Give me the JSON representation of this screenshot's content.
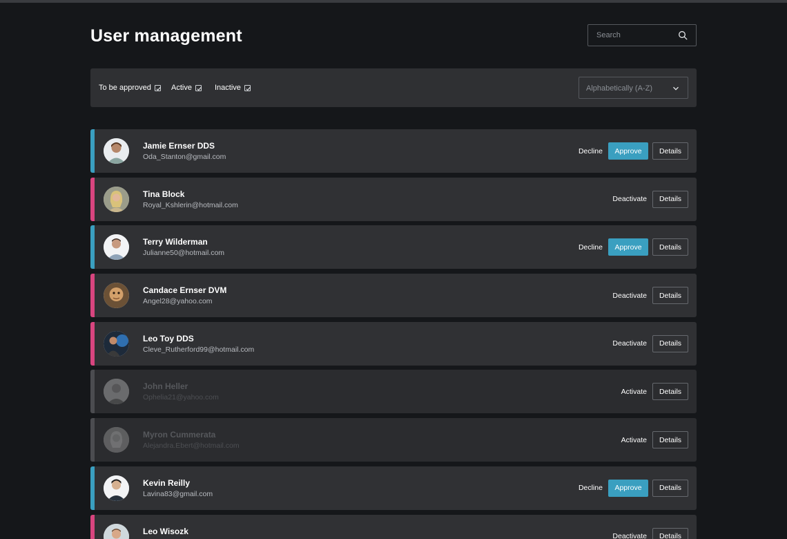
{
  "page": {
    "title": "User management"
  },
  "search": {
    "placeholder": "Search"
  },
  "filters": [
    {
      "label": "To be approved",
      "checked": true
    },
    {
      "label": "Active",
      "checked": true
    },
    {
      "label": "Inactive",
      "checked": true
    }
  ],
  "sort": {
    "selected": "Alphabetically (A-Z)"
  },
  "colors": {
    "pending": "#3a9fc0",
    "active": "#d8457f",
    "inactive": "#4b4c50",
    "approve_button": "#3a9fc0"
  },
  "users": [
    {
      "name": "Jamie Ernser DDS",
      "email": "Oda_Stanton@gmail.com",
      "status": "pending",
      "actions": [
        "Decline",
        "Approve",
        "Details"
      ]
    },
    {
      "name": "Tina Block",
      "email": "Royal_Kshlerin@hotmail.com",
      "status": "active",
      "actions": [
        "Deactivate",
        "Details"
      ]
    },
    {
      "name": "Terry Wilderman",
      "email": "Julianne50@hotmail.com",
      "status": "pending",
      "actions": [
        "Decline",
        "Approve",
        "Details"
      ]
    },
    {
      "name": "Candace Ernser DVM",
      "email": "Angel28@yahoo.com",
      "status": "active",
      "actions": [
        "Deactivate",
        "Details"
      ]
    },
    {
      "name": "Leo Toy DDS",
      "email": "Cleve_Rutherford99@hotmail.com",
      "status": "active",
      "actions": [
        "Deactivate",
        "Details"
      ]
    },
    {
      "name": "John Heller",
      "email": "Ophelia21@yahoo.com",
      "status": "inactive",
      "actions": [
        "Activate",
        "Details"
      ]
    },
    {
      "name": "Myron Cummerata",
      "email": "Alejandra.Ebert@hotmail.com",
      "status": "inactive",
      "actions": [
        "Activate",
        "Details"
      ]
    },
    {
      "name": "Kevin Reilly",
      "email": "Lavina83@gmail.com",
      "status": "pending",
      "actions": [
        "Decline",
        "Approve",
        "Details"
      ]
    },
    {
      "name": "Leo Wisozk",
      "email": "",
      "status": "active",
      "actions": [
        "Deactivate",
        "Details"
      ]
    }
  ]
}
